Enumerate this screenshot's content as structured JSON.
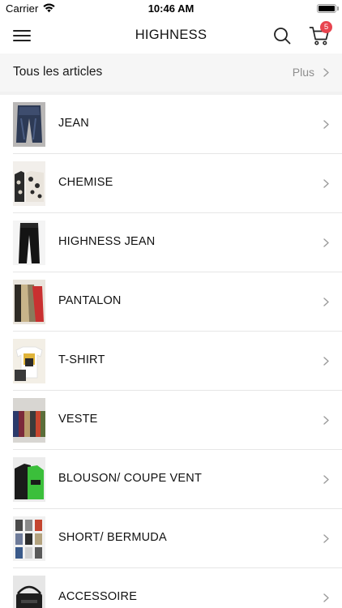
{
  "status_bar": {
    "carrier": "Carrier",
    "time": "10:46 AM"
  },
  "nav": {
    "title": "HIGHNESS",
    "cart_count": "5"
  },
  "all_articles": {
    "title": "Tous les articles",
    "more_label": "Plus"
  },
  "categories": [
    {
      "label": "JEAN"
    },
    {
      "label": "CHEMISE"
    },
    {
      "label": "HIGHNESS JEAN"
    },
    {
      "label": "PANTALON"
    },
    {
      "label": "T-SHIRT"
    },
    {
      "label": "VESTE"
    },
    {
      "label": "BLOUSON/ COUPE VENT"
    },
    {
      "label": "SHORT/ BERMUDA"
    },
    {
      "label": "ACCESSOIRE"
    }
  ],
  "colors": {
    "badge": "#e8444f",
    "secondary_text": "#8e8e8e",
    "divider": "#e6e6e6"
  }
}
